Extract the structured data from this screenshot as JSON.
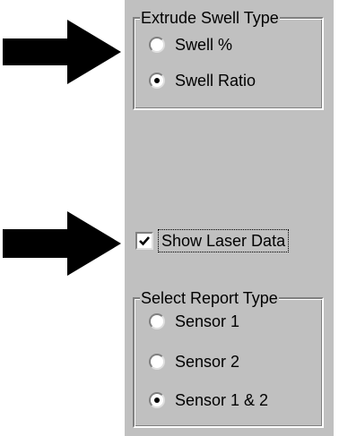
{
  "window_colors": {
    "face": "#c0c0c0",
    "shadow": "#808080",
    "highlight": "#ffffff",
    "arrow": "#000000"
  },
  "extrude_swell": {
    "title": "Extrude Swell Type",
    "options": [
      {
        "label": "Swell %",
        "checked": false
      },
      {
        "label": "Swell Ratio",
        "checked": true
      }
    ]
  },
  "laser": {
    "label": "Show Laser Data",
    "checked": true
  },
  "report": {
    "title": "Select Report Type",
    "options": [
      {
        "label": "Sensor 1",
        "checked": false
      },
      {
        "label": "Sensor 2",
        "checked": false
      },
      {
        "label": "Sensor 1 & 2",
        "checked": true
      }
    ]
  },
  "callouts": [
    {
      "icon": "right-arrow-icon",
      "points_to": "Extrude Swell Type"
    },
    {
      "icon": "right-arrow-icon",
      "points_to": "Show Laser Data"
    }
  ]
}
